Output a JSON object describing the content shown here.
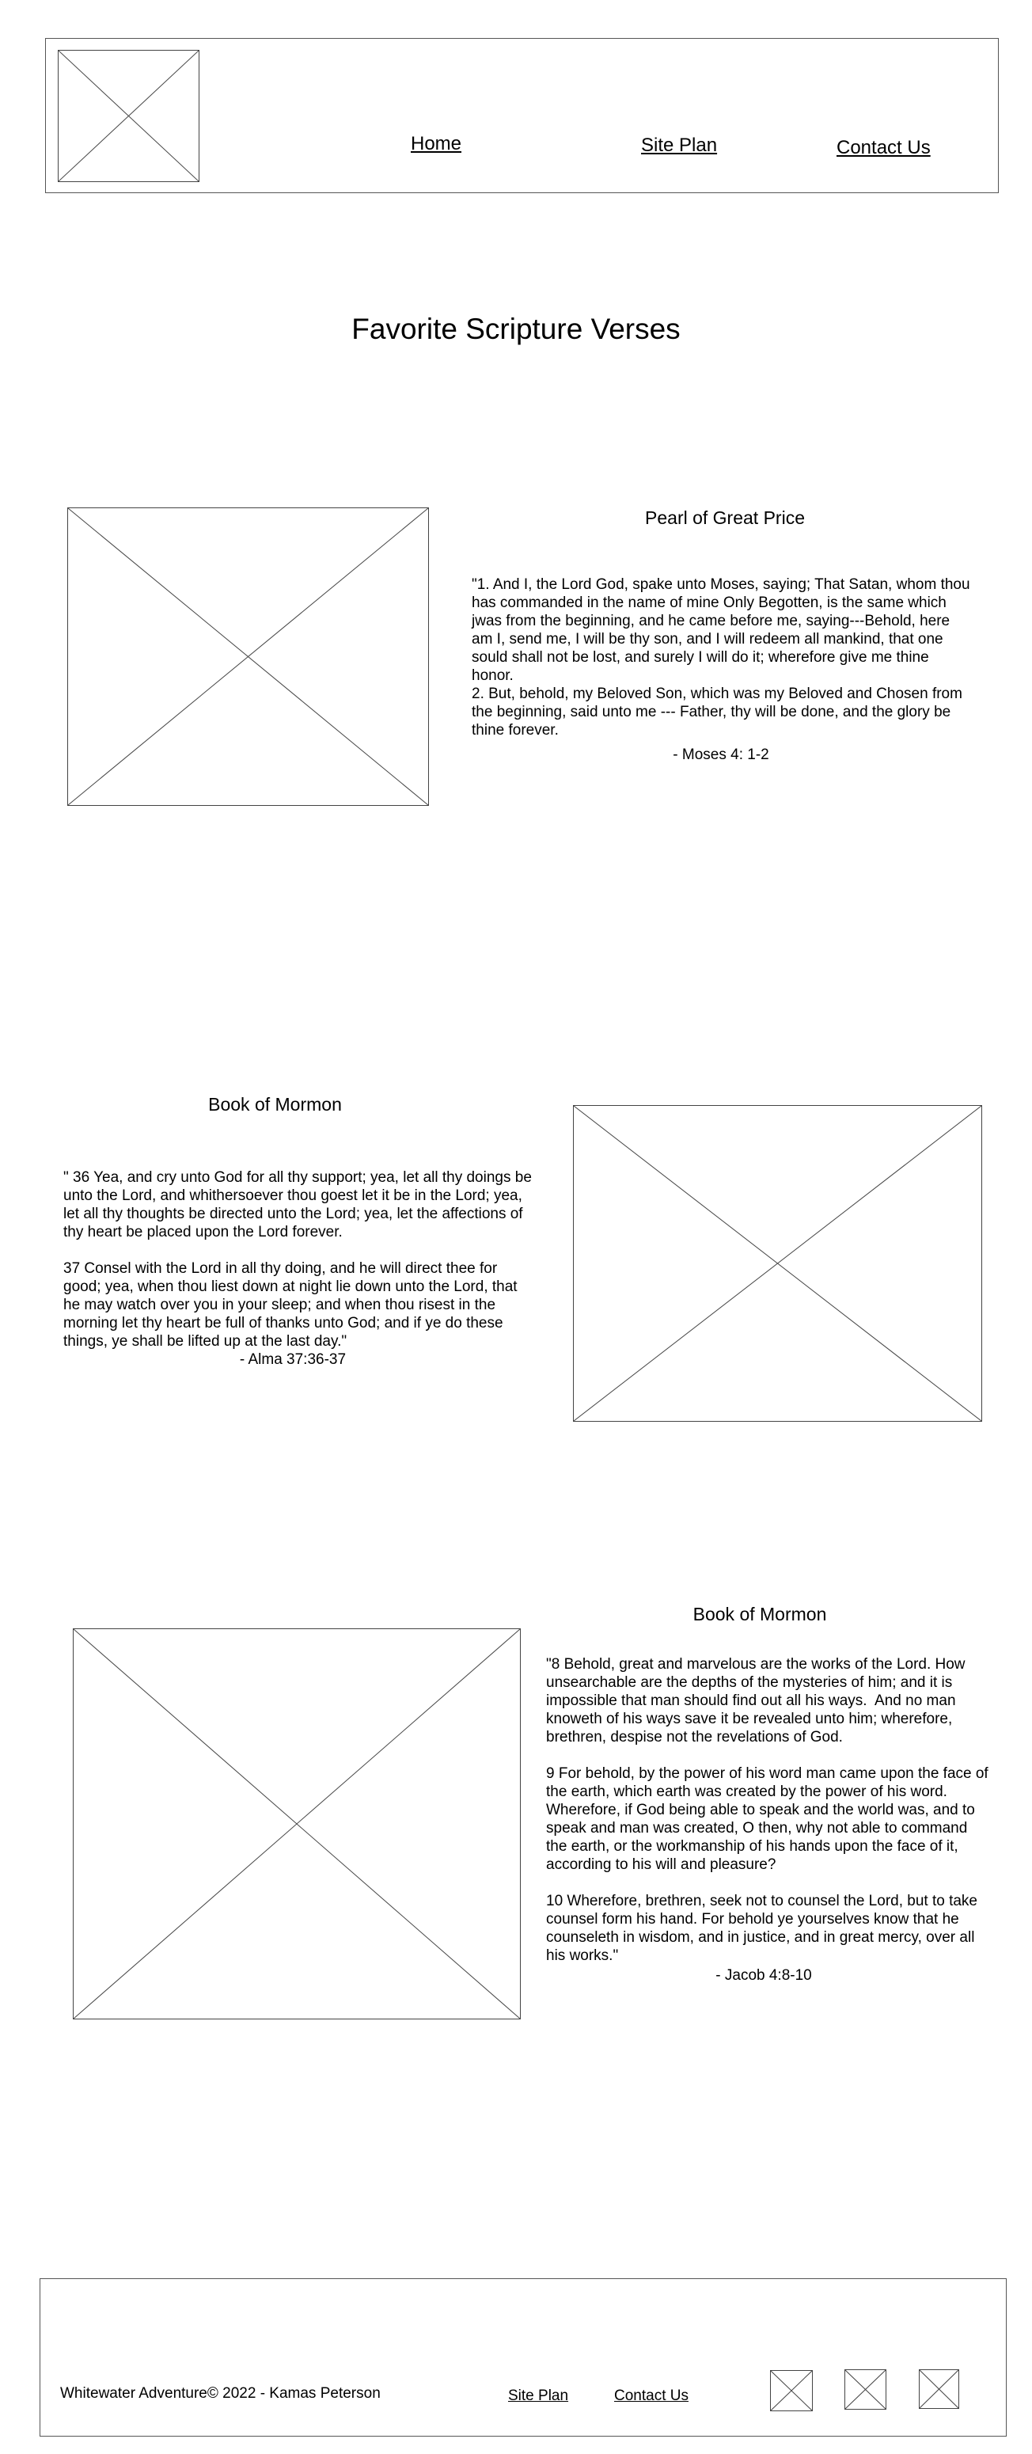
{
  "header": {
    "logo_icon": "image-placeholder-icon",
    "nav": {
      "home": "Home",
      "site_plan": "Site Plan",
      "contact": "Contact Us"
    }
  },
  "page_title": "Favorite Scripture Verses",
  "sections": [
    {
      "title": "Pearl of Great Price",
      "verse": "\"1. And I, the Lord God, spake unto Moses, saying; That Satan, whom thou has commanded in the name of mine Only Begotten, is the same which jwas from the beginning, and he came before me, saying---Behold, here am I, send me, I will be thy son, and I will redeem all mankind, that one sould shall not be lost, and surely I will do it; wherefore give me thine honor.\n2. But, behold, my Beloved Son, which was my Beloved and Chosen from the beginning, said unto me --- Father, thy will be done, and the glory be thine forever.",
      "reference": "- Moses 4: 1-2"
    },
    {
      "title": "Book of Mormon",
      "verse": "\" 36 Yea, and cry unto God for all thy support; yea, let all thy doings be unto the Lord, and whithersoever thou goest let it be in the Lord; yea, let all thy thoughts be directed unto the Lord; yea, let the affections of thy heart be placed upon the Lord forever.\n\n37 Consel with the Lord in all thy doing, and he will direct thee for good; yea, when thou liest down at night lie down unto the Lord, that he may watch over you in your sleep; and when thou risest in the morning let thy heart be full of thanks unto God; and if ye do these things, ye shall be lifted up at the last day.\"",
      "reference": "- Alma 37:36-37"
    },
    {
      "title": "Book of Mormon",
      "verse": "\"8 Behold, great and marvelous are the works of the Lord. How unsearchable are the depths of the mysteries of him; and it is impossible that man should find out all his ways.  And no man knoweth of his ways save it be revealed unto him; wherefore, brethren, despise not the revelations of God.\n\n9 For behold, by the power of his word man came upon the face of the earth, which earth was created by the power of his word. Wherefore, if God being able to speak and the world was, and to speak and man was created, O then, why not able to command the earth, or the workmanship of his hands upon the face of it, according to his will and pleasure?\n\n10 Wherefore, brethren, seek not to counsel the Lord, but to take counsel form his hand. For behold ye yourselves know that he counseleth in wisdom, and in justice, and in great mercy, over all his works.\"",
      "reference": "- Jacob 4:8-10"
    }
  ],
  "footer": {
    "copyright": "Whitewater Adventure© 2022 - Kamas Peterson",
    "site_plan": "Site Plan",
    "contact": "Contact Us",
    "social_icons": [
      "social-placeholder-icon",
      "social-placeholder-icon",
      "social-placeholder-icon"
    ]
  }
}
